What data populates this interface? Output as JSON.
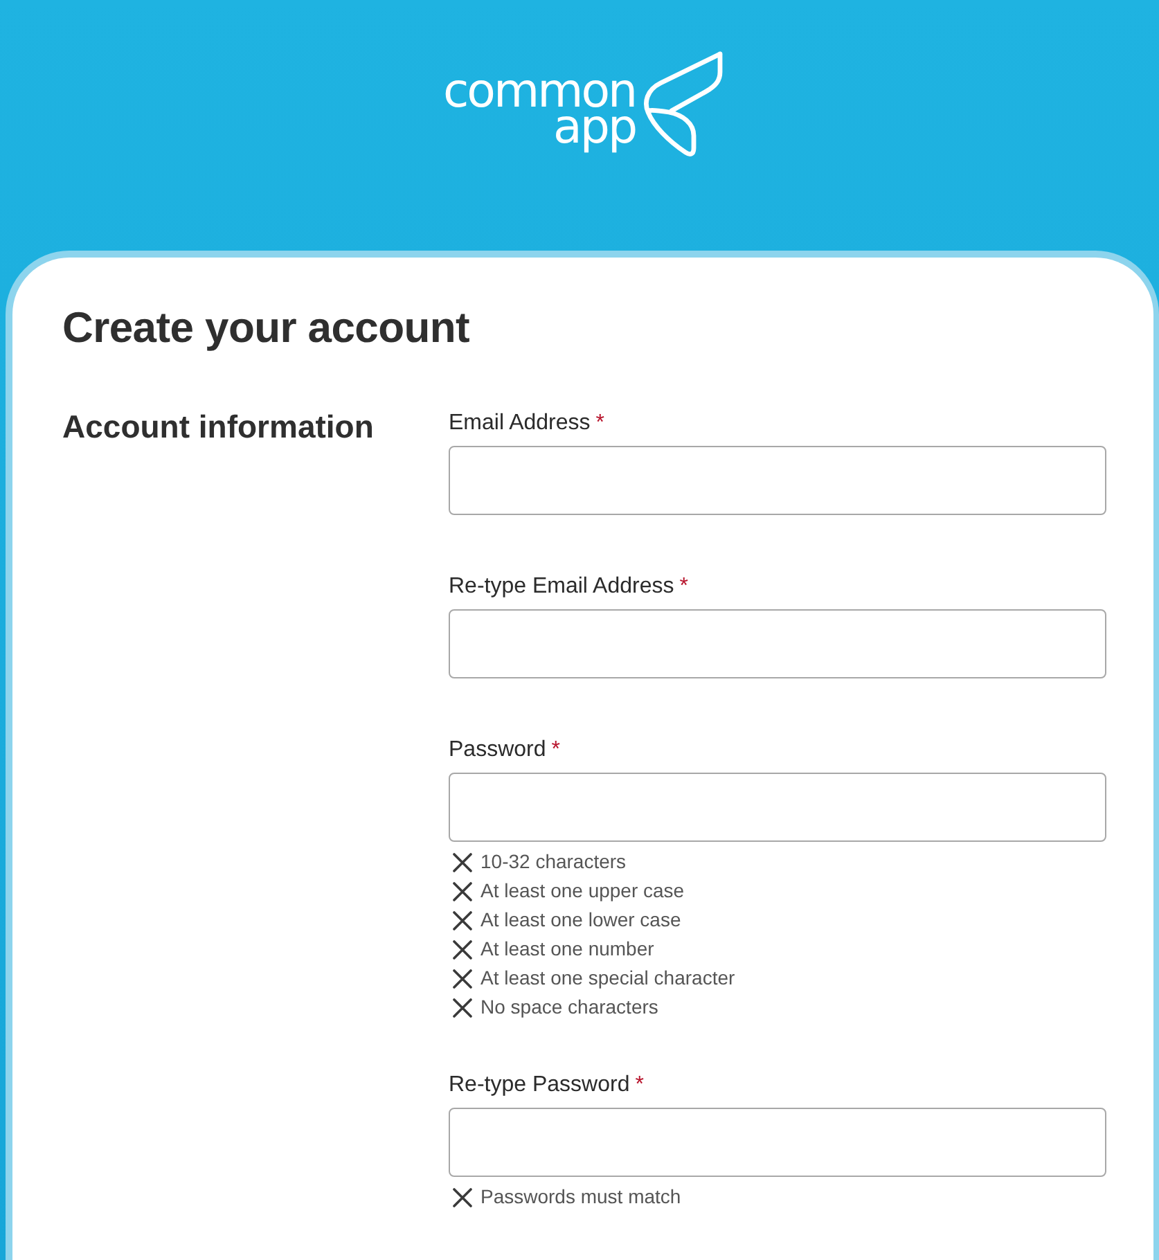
{
  "header": {
    "logo": {
      "word_1": "common",
      "word_2": "app"
    }
  },
  "page_title": "Create your account",
  "section": {
    "heading": "Account information",
    "fields": [
      {
        "label": "Email Address",
        "required": true,
        "required_mark": "*"
      },
      {
        "label": "Re-type Email Address",
        "required": true,
        "required_mark": "*"
      },
      {
        "label": "Password",
        "required": true,
        "required_mark": "*",
        "rules": [
          {
            "text": "10-32 characters",
            "met": false
          },
          {
            "text": "At least one upper case",
            "met": false
          },
          {
            "text": "At least one lower case",
            "met": false
          },
          {
            "text": "At least one number",
            "met": false
          },
          {
            "text": "At least one special character",
            "met": false
          },
          {
            "text": "No space characters",
            "met": false
          }
        ]
      },
      {
        "label": "Re-type Password",
        "required": true,
        "required_mark": "*",
        "rules": [
          {
            "text": "Passwords must match",
            "met": false
          }
        ]
      }
    ]
  }
}
